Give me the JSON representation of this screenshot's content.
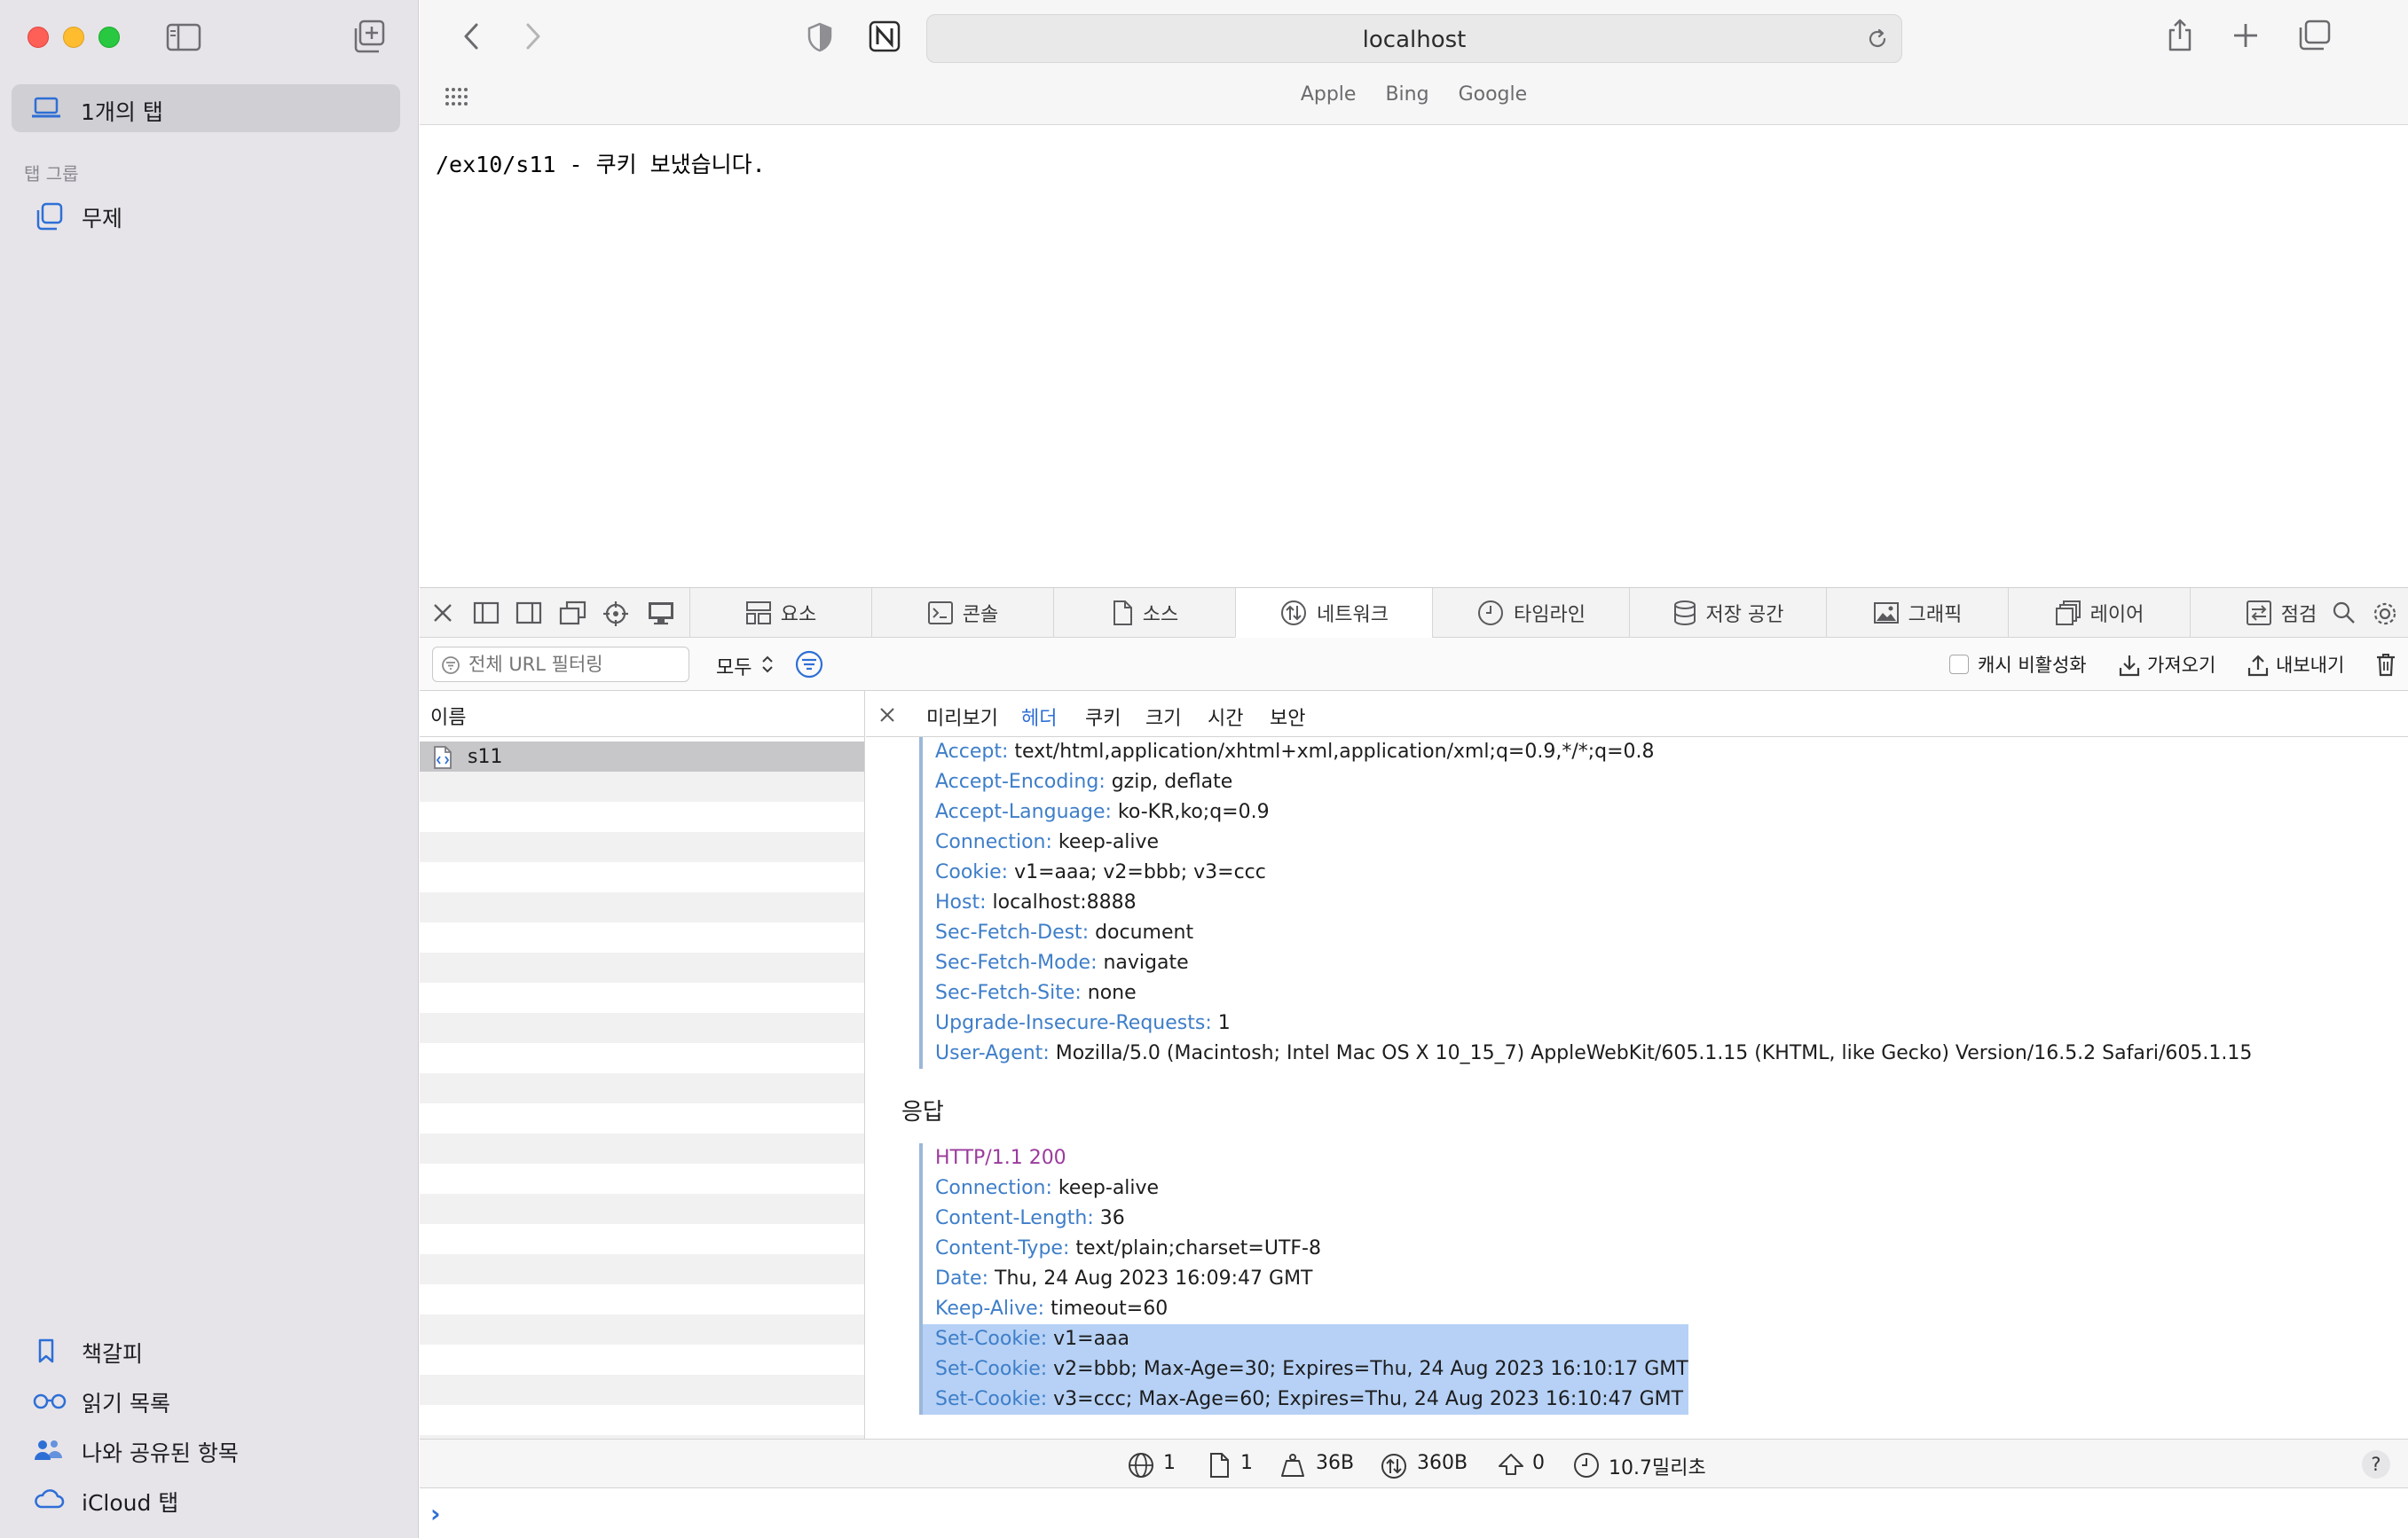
{
  "sidebar": {
    "tabs_label": "1개의 탭",
    "group_heading": "탭 그룹",
    "group_item": "무제",
    "bottom_items": [
      "책갈피",
      "읽기 목록",
      "나와 공유된 항목",
      "iCloud 탭"
    ]
  },
  "browser": {
    "url": "localhost",
    "favorites": [
      "Apple",
      "Bing",
      "Google"
    ]
  },
  "page": {
    "text": "/ex10/s11 - 쿠키 보냈습니다."
  },
  "devtools": {
    "tabs": [
      {
        "label": "요소",
        "icon": "elements-icon"
      },
      {
        "label": "콘솔",
        "icon": "console-icon"
      },
      {
        "label": "소스",
        "icon": "document-icon"
      },
      {
        "label": "네트워크",
        "icon": "network-icon",
        "active": true
      },
      {
        "label": "타임라인",
        "icon": "clock-icon"
      },
      {
        "label": "저장 공간",
        "icon": "database-icon"
      },
      {
        "label": "그래픽",
        "icon": "image-icon"
      },
      {
        "label": "레이어",
        "icon": "layers-icon"
      },
      {
        "label": "점검",
        "icon": "audit-icon"
      }
    ],
    "filter_placeholder": "전체 URL 필터링",
    "type_filter": "모두",
    "disable_cache": "캐시 비활성화",
    "import": "가져오기",
    "export": "내보내기",
    "list_header": "이름",
    "requests": [
      "s11"
    ],
    "detail_tabs": [
      "미리보기",
      "헤더",
      "쿠키",
      "크기",
      "시간",
      "보안"
    ],
    "active_detail_tab": "헤더",
    "request_headers": [
      {
        "key": "Accept",
        "value": "text/html,application/xhtml+xml,application/xml;q=0.9,*/*;q=0.8"
      },
      {
        "key": "Accept-Encoding",
        "value": "gzip, deflate"
      },
      {
        "key": "Accept-Language",
        "value": "ko-KR,ko;q=0.9"
      },
      {
        "key": "Connection",
        "value": "keep-alive"
      },
      {
        "key": "Cookie",
        "value": "v1=aaa; v2=bbb; v3=ccc"
      },
      {
        "key": "Host",
        "value": "localhost:8888"
      },
      {
        "key": "Sec-Fetch-Dest",
        "value": "document"
      },
      {
        "key": "Sec-Fetch-Mode",
        "value": "navigate"
      },
      {
        "key": "Sec-Fetch-Site",
        "value": "none"
      },
      {
        "key": "Upgrade-Insecure-Requests",
        "value": "1"
      },
      {
        "key": "User-Agent",
        "value": "Mozilla/5.0 (Macintosh; Intel Mac OS X 10_15_7) AppleWebKit/605.1.15 (KHTML, like Gecko) Version/16.5.2 Safari/605.1.15"
      }
    ],
    "response_title": "응답",
    "response_status": "HTTP/1.1 200",
    "response_headers": [
      {
        "key": "Connection",
        "value": "keep-alive"
      },
      {
        "key": "Content-Length",
        "value": "36"
      },
      {
        "key": "Content-Type",
        "value": "text/plain;charset=UTF-8"
      },
      {
        "key": "Date",
        "value": "Thu, 24 Aug 2023 16:09:47 GMT"
      },
      {
        "key": "Keep-Alive",
        "value": "timeout=60"
      },
      {
        "key": "Set-Cookie",
        "value": "v1=aaa",
        "selected": true
      },
      {
        "key": "Set-Cookie",
        "value": "v2=bbb; Max-Age=30; Expires=Thu, 24 Aug 2023 16:10:17 GMT",
        "selected": true
      },
      {
        "key": "Set-Cookie",
        "value": "v3=ccc; Max-Age=60; Expires=Thu, 24 Aug 2023 16:10:47 GMT",
        "selected": true
      }
    ],
    "status_bar": {
      "requests": "1",
      "resources": "1",
      "transferred": "36B",
      "size": "360B",
      "errors": "0",
      "time": "10.7밀리초"
    },
    "help": "?",
    "console_prompt": "›"
  },
  "colors": {
    "accent": "#2e6fd6",
    "header_key": "#3e7ec9",
    "status_text": "#9b3b9c",
    "selection": "#b6d1f5"
  }
}
